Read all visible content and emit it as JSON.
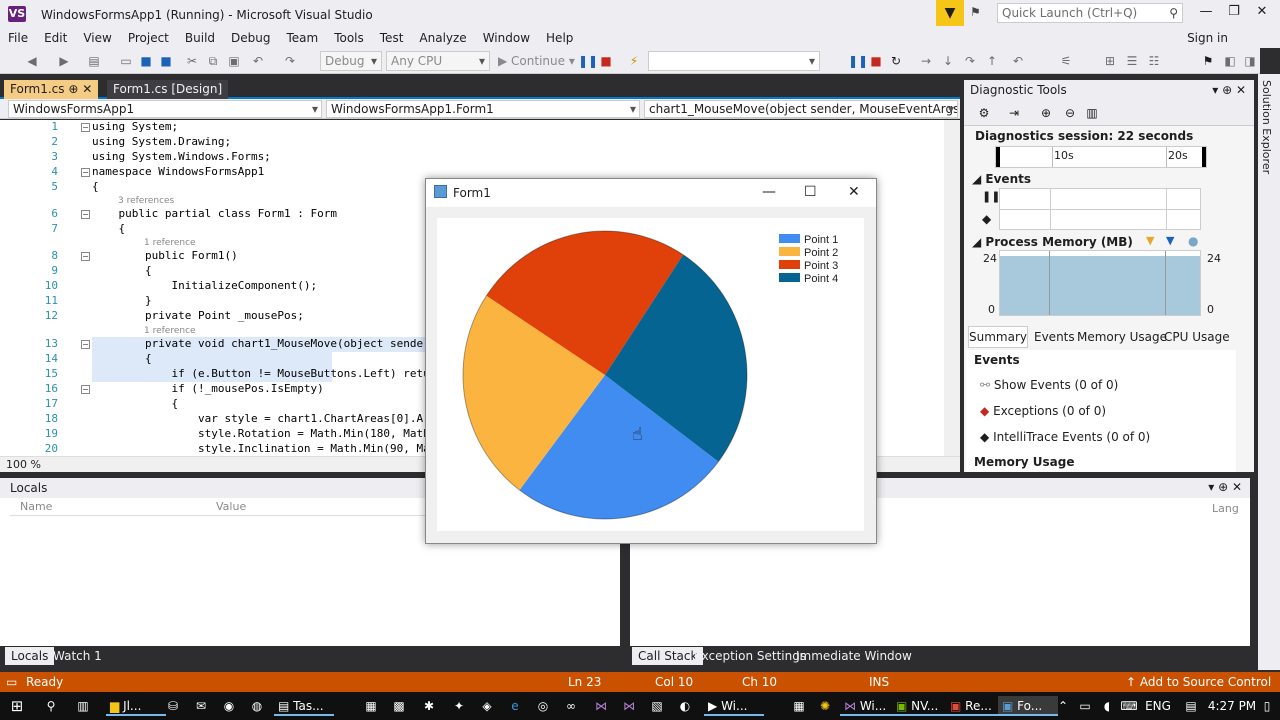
{
  "window": {
    "title": "WindowsFormsApp1 (Running) - Microsoft Visual Studio",
    "quick_launch_placeholder": "Quick Launch (Ctrl+Q)",
    "sign_in": "Sign in"
  },
  "menu": [
    "File",
    "Edit",
    "View",
    "Project",
    "Build",
    "Debug",
    "Team",
    "Tools",
    "Test",
    "Analyze",
    "Window",
    "Help"
  ],
  "toolbar": {
    "config": "Debug",
    "platform": "Any CPU",
    "continue_label": "Continue"
  },
  "editor": {
    "tabs": [
      {
        "label": "Form1.cs"
      },
      {
        "label": "Form1.cs [Design]"
      }
    ],
    "nav": {
      "project": "WindowsFormsApp1",
      "class": "WindowsFormsApp1.Form1",
      "member": "chart1_MouseMove(object sender, MouseEventArgs e)"
    },
    "zoom": "100 %",
    "lines": [
      {
        "n": "1",
        "code": "using System;"
      },
      {
        "n": "2",
        "code": "using System.Drawing;"
      },
      {
        "n": "3",
        "code": "using System.Windows.Forms;"
      },
      {
        "n": "4",
        "code": "namespace WindowsFormsApp1"
      },
      {
        "n": "5",
        "code": "{"
      },
      {
        "n": "6",
        "code": "    public partial class Form1 : Form"
      },
      {
        "n": "7",
        "code": "    {"
      },
      {
        "n": "8",
        "code": "        public Form1()"
      },
      {
        "n": "9",
        "code": "        {"
      },
      {
        "n": "10",
        "code": "            InitializeComponent();"
      },
      {
        "n": "11",
        "code": "        }"
      },
      {
        "n": "12",
        "code": "        private Point _mousePos;"
      },
      {
        "n": "13",
        "code": "        private void chart1_MouseMove(object sender"
      },
      {
        "n": "14",
        "code": "        {"
      },
      {
        "n": "15",
        "code": "            if (e.Button != MouseButtons.Left) retu"
      },
      {
        "n": "16",
        "code": "            if (!_mousePos.IsEmpty)"
      },
      {
        "n": "17",
        "code": "            {"
      },
      {
        "n": "18",
        "code": "                var style = chart1.ChartAreas[0].Ar"
      },
      {
        "n": "19",
        "code": "                style.Rotation = Math.Min(180, Math"
      },
      {
        "n": "20",
        "code": "                style.Inclination = Math.Min(90, Ma"
      }
    ],
    "refs": {
      "r1": "3 references",
      "r2": "1 reference",
      "r3": "1 reference"
    }
  },
  "locals": {
    "title": "Locals",
    "col_name": "Name",
    "col_value": "Value",
    "lang_col": "Lang"
  },
  "bottom_tabs_left": [
    "Locals",
    "Watch 1"
  ],
  "bottom_tabs_right": [
    "Call Stack",
    "Exception Settings",
    "Immediate Window"
  ],
  "diagnostics": {
    "title": "Diagnostic Tools",
    "session": "Diagnostics session: 22 seconds",
    "t10": "10s",
    "t20": "20s",
    "events_label": "Events",
    "memory_label": "Process Memory (MB)",
    "mem_max": "24",
    "mem_min": "0",
    "tabs": [
      "Summary",
      "Events",
      "Memory Usage",
      "CPU Usage"
    ],
    "events_header": "Events",
    "rows": [
      "Show Events (0 of 0)",
      "Exceptions (0 of 0)",
      "IntelliTrace Events (0 of 0)"
    ],
    "memory_usage": "Memory Usage"
  },
  "solution_explorer": "Solution Explorer",
  "form1": {
    "title": "Form1"
  },
  "chart_data": {
    "type": "pie",
    "categories": [
      "Point 1",
      "Point 2",
      "Point 3",
      "Point 4"
    ],
    "values": [
      25,
      24,
      25,
      26
    ],
    "colors": [
      "#418cf0",
      "#fcb441",
      "#e0400a",
      "#056492"
    ],
    "legend": "top-right"
  },
  "status": {
    "ready": "Ready",
    "ln": "Ln 23",
    "col": "Col 10",
    "ch": "Ch 10",
    "ins": "INS",
    "source_control": "Add to Source Control"
  },
  "taskbar": {
    "apps": [
      "Jl...",
      "Tas...",
      "Wi...",
      "Wi...",
      "NV...",
      "Re...",
      "Fo..."
    ],
    "lang": "ENG",
    "time": "4:27 PM"
  }
}
